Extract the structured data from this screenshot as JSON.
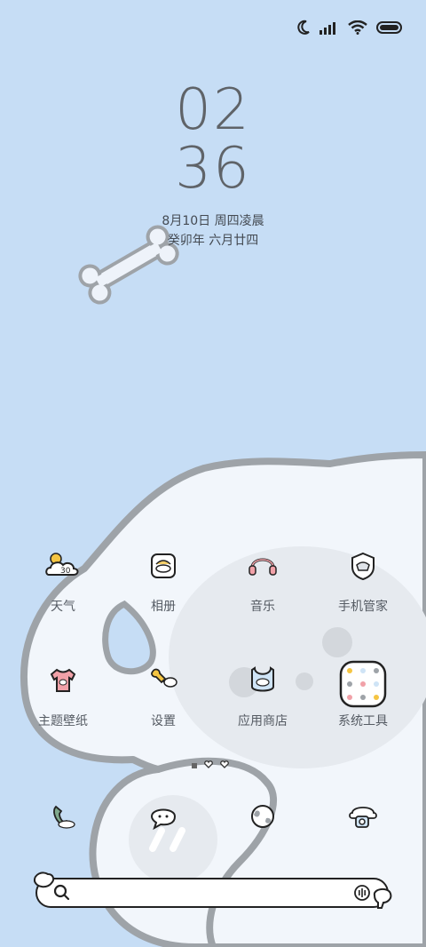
{
  "clock": {
    "hours": "02",
    "minutes": "36"
  },
  "date": {
    "line1": "8月10日 周四凌晨",
    "line2": "癸卯年 六月廿四"
  },
  "status_icons": [
    "moon-icon",
    "signal-icon",
    "wifi-icon",
    "battery-icon"
  ],
  "apps": [
    {
      "label": "天气",
      "icon": "weather-icon"
    },
    {
      "label": "相册",
      "icon": "gallery-icon"
    },
    {
      "label": "音乐",
      "icon": "headphones-icon"
    },
    {
      "label": "手机管家",
      "icon": "shield-icon"
    },
    {
      "label": "主题壁纸",
      "icon": "tshirt-icon"
    },
    {
      "label": "设置",
      "icon": "wrench-icon"
    },
    {
      "label": "应用商店",
      "icon": "bib-icon"
    },
    {
      "label": "系统工具",
      "icon": "folder-icon"
    }
  ],
  "weather_temp": "30",
  "dock": [
    "phone-icon",
    "messages-icon",
    "browser-icon",
    "camera-icon"
  ],
  "page_indicator": {
    "pages": 3,
    "current": 1
  },
  "search": {
    "placeholder": ""
  },
  "colors": {
    "background": "#c6ddf5",
    "dog": "#f2f6fb",
    "outline": "#9ea3a8"
  }
}
